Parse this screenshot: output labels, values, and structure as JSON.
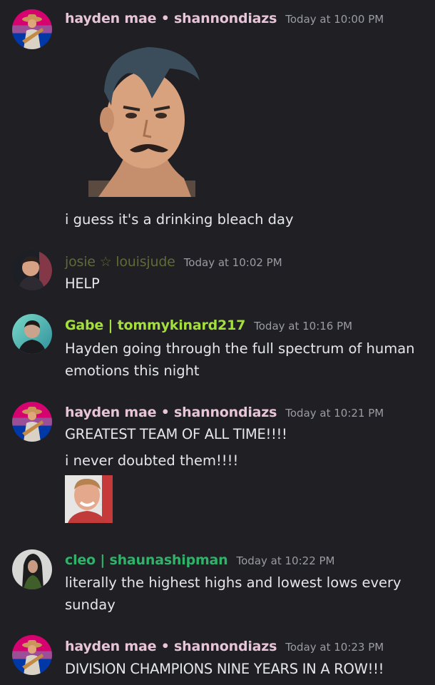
{
  "messages": [
    {
      "author": "hayden mae • shannondiazs",
      "author_color": "#e7c4d8",
      "timestamp": "Today at 10:00 PM",
      "avatar": "flag-cowboy-avatar",
      "attachment": "mustache-man-sticker",
      "lines": [
        "i guess it's a drinking bleach day"
      ]
    },
    {
      "author": "josie ☆ louisjude",
      "author_color": "#5f6b35",
      "timestamp": "Today at 10:02 PM",
      "avatar": "dark-hair-man-avatar",
      "lines": [
        "HELP"
      ]
    },
    {
      "author": "Gabe | tommykinard217",
      "author_color": "#a4df3d",
      "timestamp": "Today at 10:16 PM",
      "avatar": "teal-portrait-avatar",
      "lines": [
        "Hayden going through the full spectrum of human",
        "emotions this night"
      ]
    },
    {
      "author": "hayden mae • shannondiazs",
      "author_color": "#e7c4d8",
      "timestamp": "Today at 10:21 PM",
      "avatar": "flag-cowboy-avatar",
      "lines": [
        "GREATEST TEAM OF ALL TIME!!!!",
        "i never doubted them!!!!"
      ],
      "attachment": "smiling-man-thumbnail"
    },
    {
      "author": "cleo | shaunashipman",
      "author_color": "#2fb36a",
      "timestamp": "Today at 10:22 PM",
      "avatar": "woman-portrait-avatar",
      "lines": [
        "literally the highest highs and lowest lows every",
        "sunday"
      ]
    },
    {
      "author": "hayden mae • shannondiazs",
      "author_color": "#e7c4d8",
      "timestamp": "Today at 10:23 PM",
      "avatar": "flag-cowboy-avatar",
      "lines": [
        "DIVISION CHAMPIONS NINE YEARS IN A ROW!!!"
      ]
    }
  ]
}
